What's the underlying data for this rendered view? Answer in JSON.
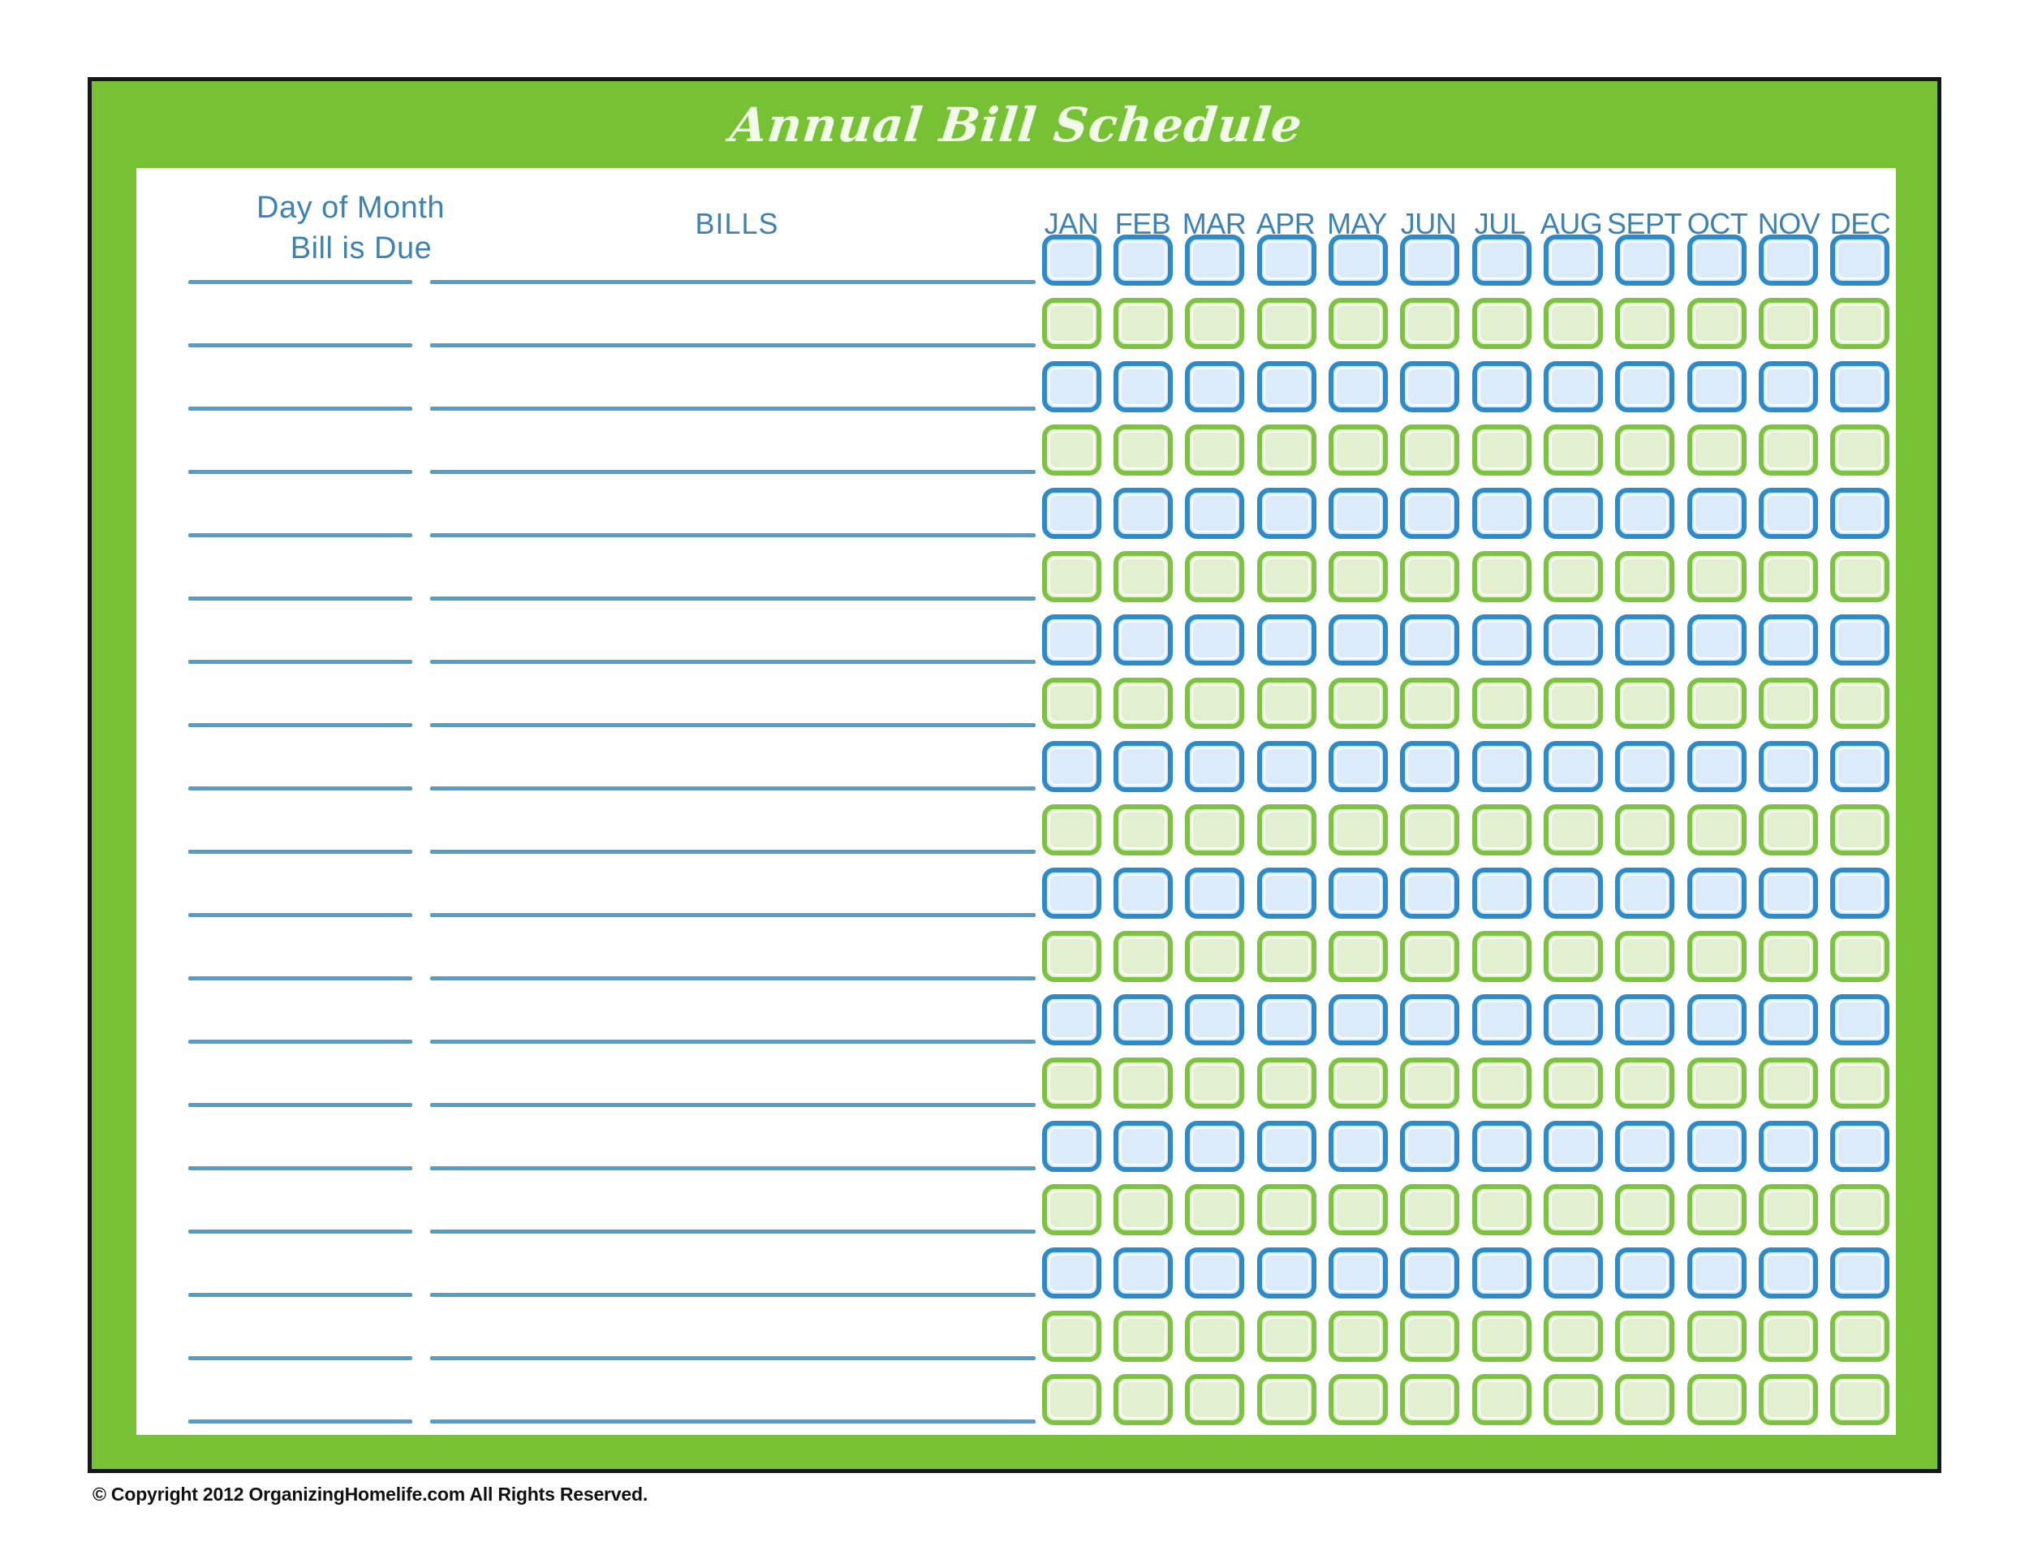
{
  "document": {
    "title": "Annual Bill Schedule",
    "copyright": "© Copyright 2012 OrganizingHomelife.com All Rights Reserved.",
    "accent_green": "#76c134",
    "accent_blue": "#3e82b4",
    "checkbox_blue_border": "#2e8bc8",
    "checkbox_blue_fill": "#dcebf9",
    "checkbox_green_border": "#7dc242",
    "checkbox_green_fill": "#e3f0cf",
    "rule_color": "#539ec9"
  },
  "headers": {
    "day_of_month_line1": "Day of Month",
    "day_of_month_line2": "Bill is Due",
    "bills": "BILLS",
    "months": [
      "JAN",
      "FEB",
      "MAR",
      "APR",
      "MAY",
      "JUN",
      "JUL",
      "AUG",
      "SEPT",
      "OCT",
      "NOV",
      "DEC"
    ]
  },
  "table": {
    "row_count": 19,
    "column_count": 12,
    "row_colors": [
      "blue",
      "green",
      "blue",
      "green",
      "blue",
      "green",
      "blue",
      "green",
      "blue",
      "green",
      "blue",
      "green",
      "blue",
      "green",
      "blue",
      "green",
      "blue",
      "green",
      "green"
    ],
    "line_row_count": 19,
    "day_value": "",
    "bill_value": "",
    "checkbox_state": "unchecked"
  }
}
